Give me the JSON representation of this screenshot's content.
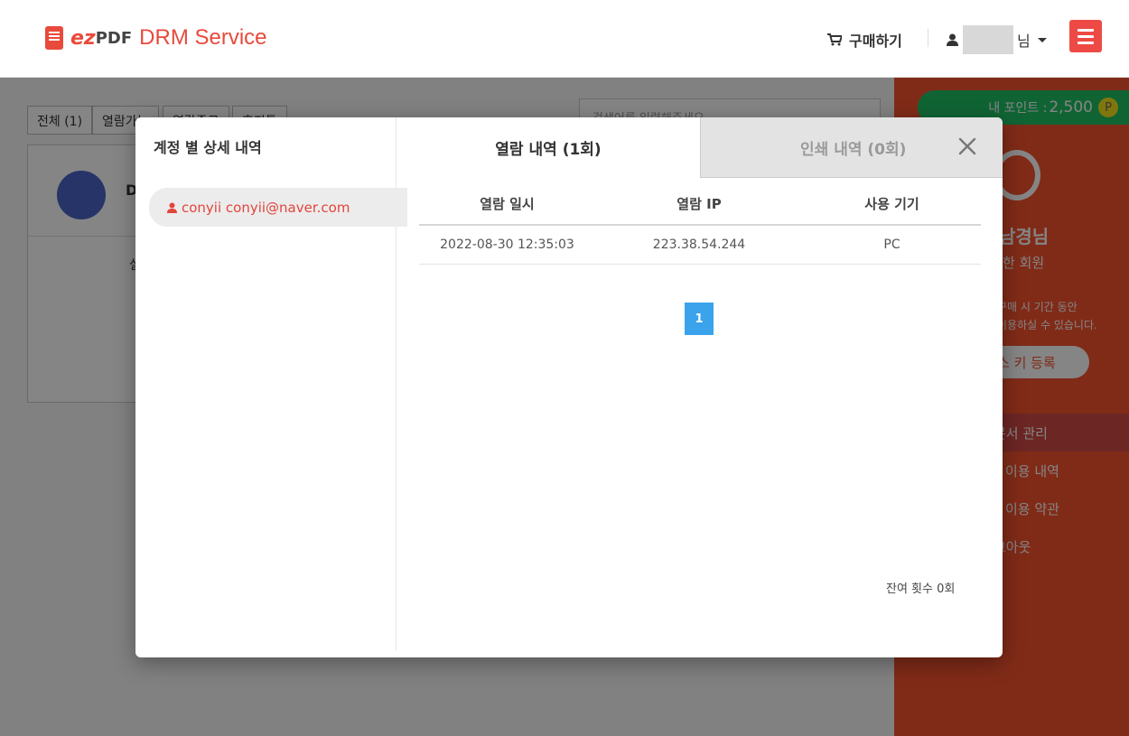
{
  "header": {
    "logo": {
      "ez": "ez",
      "pdf": "PDF",
      "service": "DRM Service"
    },
    "cart_label": "구매하기",
    "user_suffix": "님"
  },
  "background": {
    "filters": [
      "전체 (1)",
      "열람가능",
      "열람종료",
      "휴지통"
    ],
    "search_placeholder": "검색어를 입력해주세요",
    "card_letter": "D",
    "card_text": "실"
  },
  "sidebar": {
    "points_label": "내 포인트 :",
    "points_value": "2,500",
    "points_badge": "P",
    "user_name": "남경님",
    "user_grade": "한 회원",
    "desc_line1": "구매 시 기간 동안",
    "desc_line2": "이용하실 수 있습니다.",
    "key_button": "스 키 등록",
    "nav": [
      "문서 관리",
      "이용 내역",
      "이용 약관",
      "그아웃"
    ]
  },
  "modal": {
    "title": "계정 별 상세 내역",
    "account": "conyii conyii@naver.com",
    "tabs": {
      "view": "열람 내역 (1회)",
      "print": "인쇄 내역 (0회)"
    },
    "columns": [
      "열람 일시",
      "열람 IP",
      "사용 기기"
    ],
    "rows": [
      {
        "datetime": "2022-08-30 12:35:03",
        "ip": "223.38.54.244",
        "device": "PC"
      }
    ],
    "page": "1",
    "remaining": "잔여 횟수 0회"
  },
  "colors": {
    "brand_red": "#e84a3c",
    "sidebar_orange": "#f5532f",
    "points_green": "#20c064",
    "pagination_blue": "#3aa3ec"
  },
  "icons": [
    "cart-icon",
    "user-icon",
    "menu-icon",
    "close-icon",
    "copy-icon"
  ]
}
